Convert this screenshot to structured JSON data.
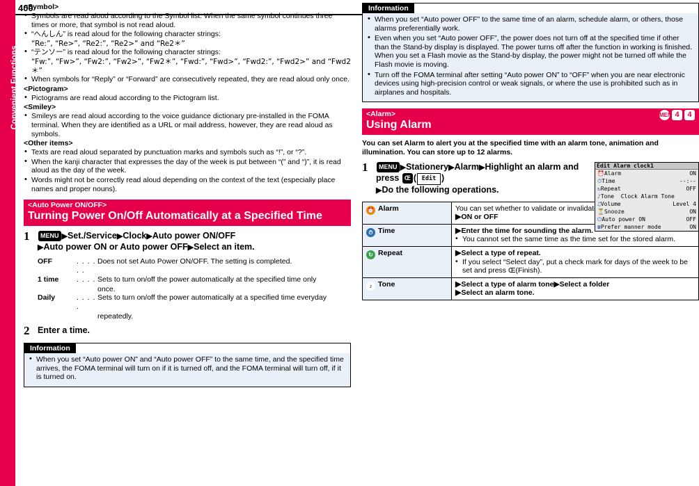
{
  "page": {
    "number": "400",
    "side_tab": "Convenient Functions"
  },
  "left": {
    "symbol_heading": "<Symbol>",
    "symbol_items": [
      "Symbols are read aloud according to the Symbol list. When the same symbol continues three times or more, that symbol is not read aloud.",
      "“へんしん” is read aloud for the following character strings:",
      "“テンソー” is read aloud for the following character strings:",
      "When symbols for “Reply” or “Forward” are consecutively repeated, they are read aloud only once."
    ],
    "symbol_sub1": "“Re:”, “Re>”, “Re2:”, “Re2>” and “Re2＊”",
    "symbol_sub2": "“Fw:”, “Fw>”, “Fw2:”, “Fw2>”, “Fw2＊”, “Fwd:”, “Fwd>”, “Fwd2:”, “Fwd2>” and “Fwd2＊”",
    "pictogram_heading": "<Pictogram>",
    "pictogram_items": [
      "Pictograms are read aloud according to the Pictogram list."
    ],
    "smiley_heading": "<Smiley>",
    "smiley_items": [
      "Smileys are read aloud according to the voice guidance dictionary pre-installed in the FOMA terminal. When they are identified as a URL or mail address, however, they are read aloud as symbols."
    ],
    "other_heading": "<Other items>",
    "other_items": [
      "Texts are read aloud separated by punctuation marks and symbols such as “!”, or “?”.",
      "When the kanji character that expresses the day of the week is put between “(” and “)”, it is read aloud as the day of the week.",
      "Words might not be correctly read aloud depending on the context of the text (especially place names and proper nouns)."
    ],
    "section": {
      "small": "<Auto Power ON/OFF>",
      "big": "Turning Power On/Off Automatically at a Specified Time"
    },
    "step1": {
      "num": "1",
      "menu_key": "MENU",
      "parts": [
        "Set./Service",
        "Clock",
        "Auto power ON/OFF",
        "Auto power ON or Auto power OFF",
        "Select an item."
      ]
    },
    "options": [
      {
        "term": "OFF",
        "dots": ". . . . . .",
        "body": "Does not set Auto Power ON/OFF. The setting is completed."
      },
      {
        "term": "1 time",
        "dots": ". . . .",
        "body": "Sets to turn on/off the power automatically at the specified time only",
        "cont": "once."
      },
      {
        "term": "Daily",
        "dots": ". . . . .",
        "body": "Sets to turn on/off the power automatically at a specified time everyday",
        "cont": "repeatedly."
      }
    ],
    "step2": {
      "num": "2",
      "text": "Enter a time."
    },
    "info": {
      "header": "Information",
      "items": [
        "When you set “Auto power ON” and “Auto power OFF” to the same time, and the specified time arrives, the FOMA terminal will turn on if it is turned off, and the FOMA terminal will turn off, if it is turned on."
      ]
    }
  },
  "right": {
    "info": {
      "header": "Information",
      "items": [
        "When you set “Auto power OFF” to the same time of an alarm, schedule alarm, or others, those alarms preferentially work.",
        "Even when you set “Auto power OFF”, the power does not turn off at the specified time if other than the Stand-by display is displayed. The power turns off after the function in working is finished. When you set a Flash movie as the Stand-by display, the power might not be turned off while the Flash movie is moving.",
        "Turn off the FOMA terminal after setting “Auto power ON” to “OFF” when you are near electronic devices using high-precision control or weak signals, or where the use is prohibited such as in airplanes and hospitals."
      ]
    },
    "section": {
      "small": "<Alarm>",
      "big": "Using Alarm",
      "keys": [
        "MENU",
        "4",
        "4"
      ]
    },
    "lead": "You can set Alarm to alert you at the specified time with an alarm tone, animation and illumination. You can store up to 12 alarms.",
    "step1": {
      "num": "1",
      "menu_key": "MENU",
      "parts": [
        "Stationery",
        "Alarm",
        "Highlight an alarm and press"
      ],
      "lkey": "Œ",
      "lcd": "Edit",
      "last": "Do the following operations."
    },
    "screenshot": {
      "title": "Edit Alarm clock1",
      "rows": [
        {
          "icon": "alarm-icon",
          "label": "Alarm",
          "value": "ON"
        },
        {
          "icon": "time-icon",
          "label": "Time",
          "value": "--:--"
        },
        {
          "icon": "repeat-icon",
          "label": "Repeat",
          "value": "OFF"
        },
        {
          "icon": "tone-icon",
          "label": "Tone  Clock Alarm Tone",
          "value": ""
        },
        {
          "icon": "volume-icon",
          "label": "Volume",
          "value": "Level 4"
        },
        {
          "icon": "snooze-icon",
          "label": "Snooze",
          "value": "ON"
        },
        {
          "icon": "power-icon",
          "label": "Auto power ON",
          "value": "OFF"
        },
        {
          "icon": "manner-icon",
          "label": "Prefer manner mode",
          "value": "ON"
        }
      ]
    },
    "table": [
      {
        "icon": "alarm-icon",
        "term": "Alarm",
        "lines": [
          {
            "type": "text",
            "text": "You can set whether to validate or invalidate the alarm."
          },
          {
            "type": "arrow",
            "text": "ON or OFF"
          }
        ]
      },
      {
        "icon": "time-icon",
        "term": "Time",
        "lines": [
          {
            "type": "arrow",
            "text": "Enter the time for sounding the alarm."
          },
          {
            "type": "bullet",
            "text": "You cannot set the same time as the time set for the stored alarm."
          }
        ]
      },
      {
        "icon": "repeat-icon",
        "term": "Repeat",
        "lines": [
          {
            "type": "arrow",
            "text": "Select a type of repeat."
          },
          {
            "type": "bullet",
            "text": "If you select “Select day”, put a check mark for days of the week to be set and press Œ(Finish)."
          }
        ]
      },
      {
        "icon": "tone-icon",
        "term": "Tone",
        "lines": [
          {
            "type": "arrow",
            "text": "Select a type of alarm tone▶Select a folder"
          },
          {
            "type": "arrow",
            "text": "Select an alarm tone."
          }
        ]
      }
    ]
  },
  "colors": {
    "accent": "#e6004c",
    "info_bg": "#eaf0f8"
  }
}
